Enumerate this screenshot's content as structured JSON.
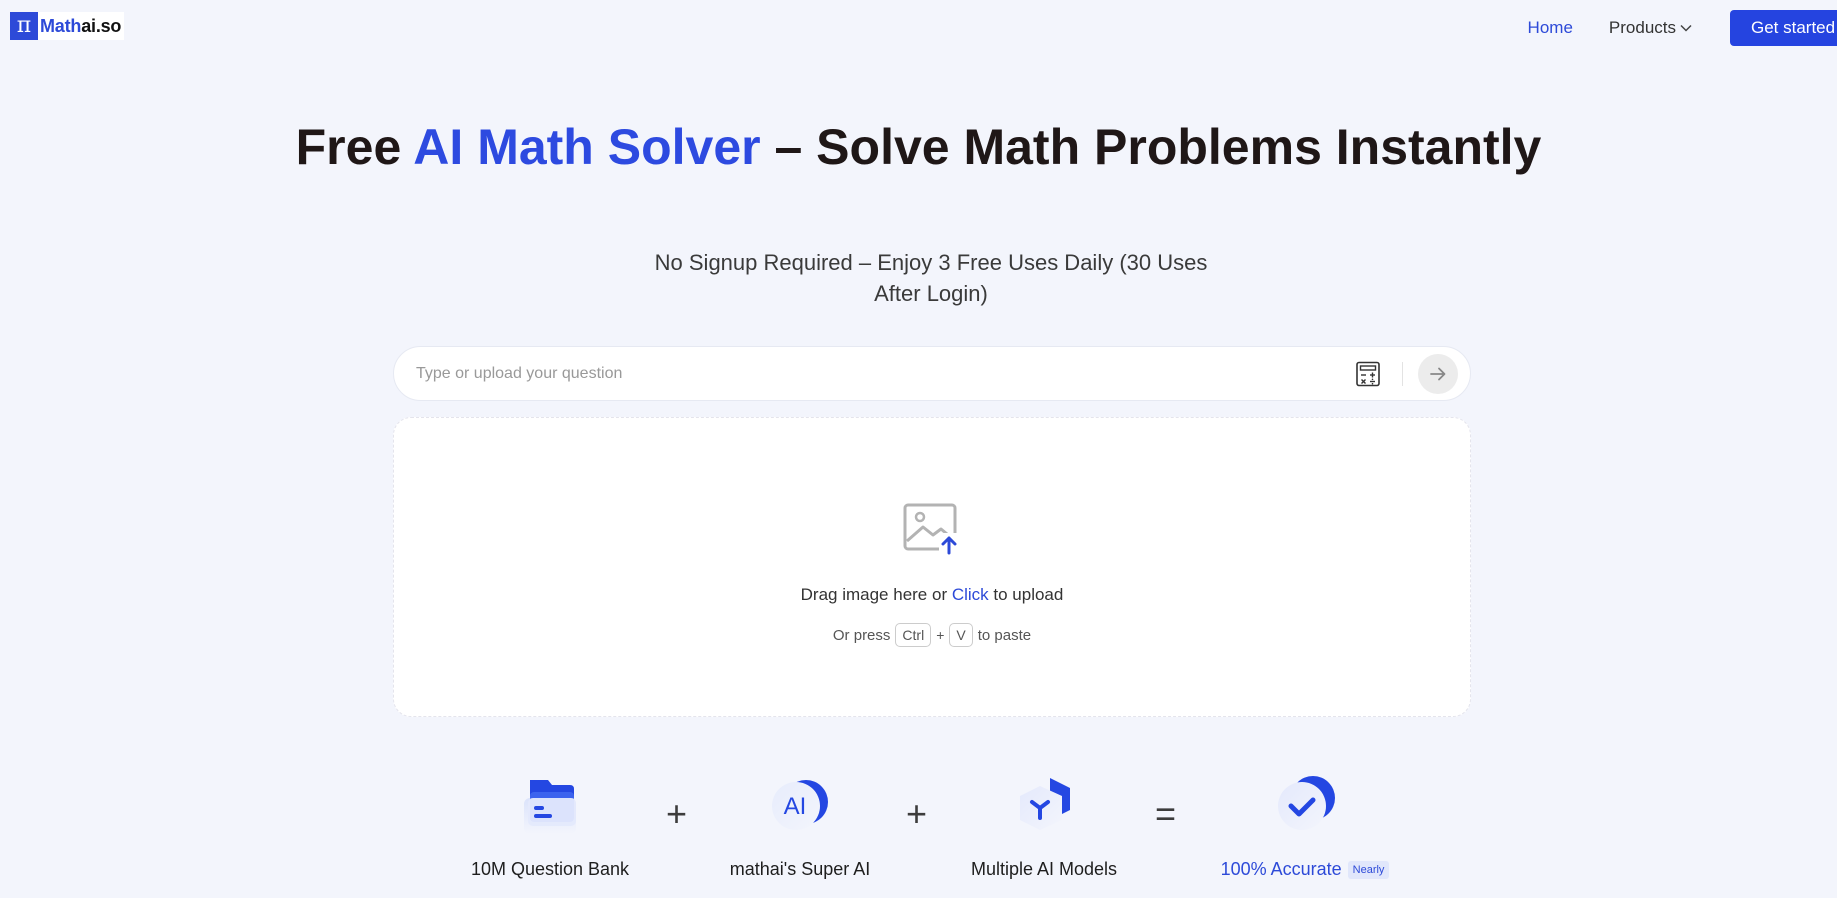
{
  "brand": {
    "logo_glyph": "π",
    "name_part1": "Math",
    "name_part2": "ai.so",
    "accent_color": "#2d4ad8"
  },
  "nav": {
    "home": "Home",
    "products": "Products",
    "cta": "Get started"
  },
  "hero": {
    "title_pre": "Free ",
    "title_accent": "AI Math Solver",
    "title_post": " – Solve Math Problems Instantly",
    "subtitle": "No Signup Required – Enjoy 3 Free Uses Daily (30 Uses After Login)"
  },
  "search": {
    "placeholder": "Type or upload your question",
    "value": ""
  },
  "upload": {
    "drag_pre": "Drag image here or ",
    "drag_link": "Click",
    "drag_post": " to upload",
    "paste_pre": "Or press",
    "key1": "Ctrl",
    "plus": "+",
    "key2": "V",
    "paste_post": "to paste"
  },
  "features": [
    {
      "label": "10M Question Bank",
      "icon": "folder-icon"
    },
    {
      "label": "mathai's Super AI",
      "icon": "ai-icon"
    },
    {
      "label": "Multiple AI Models",
      "icon": "cube-icon"
    },
    {
      "label": "100% Accurate",
      "icon": "check-icon",
      "badge": "Nearly"
    }
  ],
  "operators": {
    "plus": "+",
    "equals": "="
  }
}
